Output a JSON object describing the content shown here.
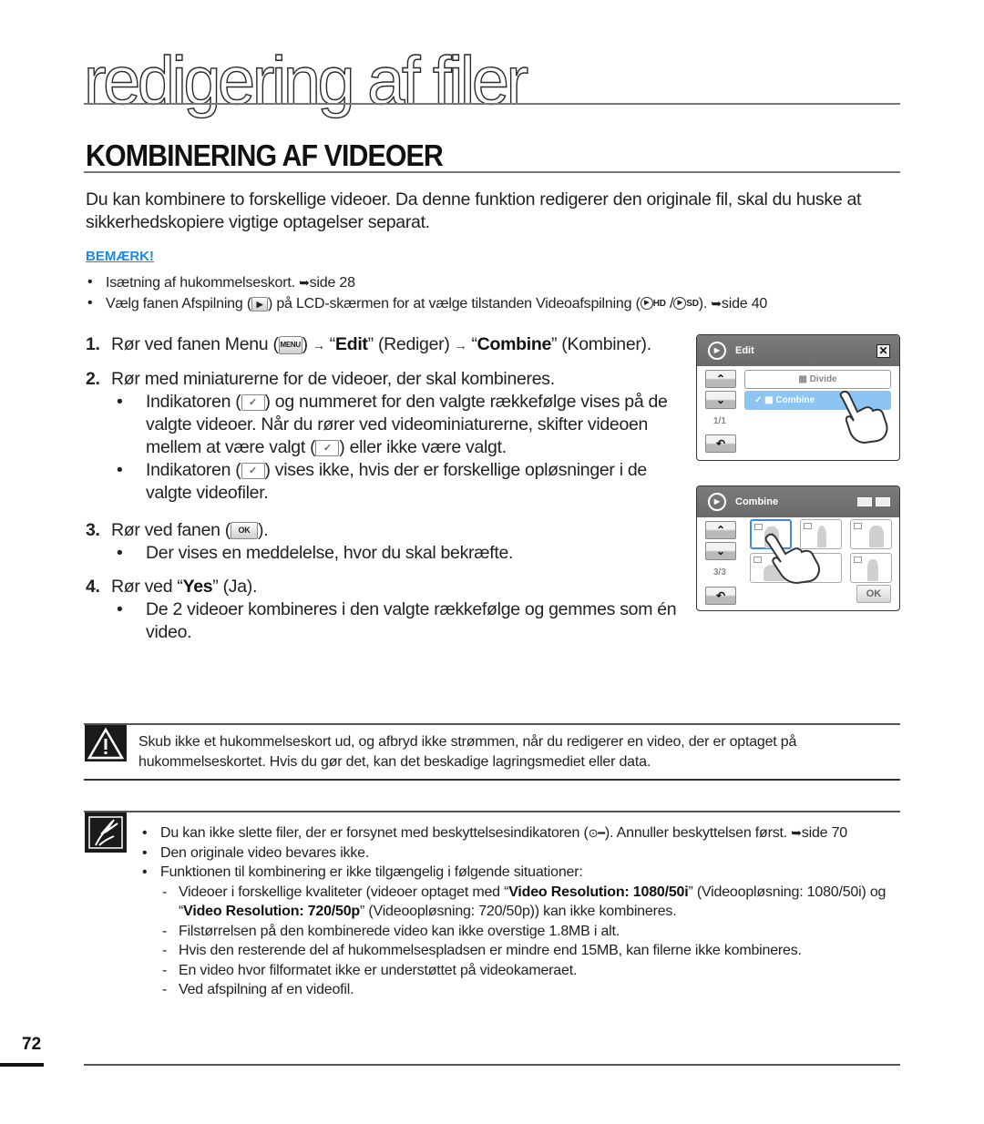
{
  "header": {
    "chapter_title": "redigering af filer",
    "section_title": "KOMBINERING AF VIDEOER"
  },
  "intro": "Du kan kombinere to forskellige videoer. Da denne funktion redigerer den originale fil, skal du huske at sikkerhedskopiere vigtige optagelser separat.",
  "note": {
    "label": "BEMÆRK!",
    "items": [
      {
        "text": "Isætning af hukommelseskort. ",
        "ref_arrow": "➥",
        "ref": "side 28"
      },
      {
        "text_before": "Vælg fanen Afspilning (",
        "icon": "play-tab-icon",
        "text_mid": ") på LCD-skærmen for at vælge tilstanden Videoafspilning (",
        "mode_hd": "HD",
        "mode_sd": "SD",
        "text_after": "). ",
        "ref_arrow": "➥",
        "ref": "side 40"
      }
    ]
  },
  "steps": [
    {
      "num": "1.",
      "parts": {
        "a": "Rør ved fanen Menu (",
        "menu_icon": "MENU",
        "b": ") ",
        "arrow": "→",
        "c": " “",
        "edit": "Edit",
        "d": "” (Rediger) ",
        "e": " “",
        "combine": "Combine",
        "f": "” (Kombiner)."
      }
    },
    {
      "num": "2.",
      "text": "Rør med miniaturerne for de videoer, der skal kombineres.",
      "subs": [
        {
          "a": "Indikatoren (",
          "b": ") og nummeret for den valgte rækkefølge vises på de valgte videoer. Når du rører ved videominiaturerne, skifter videoen mellem at være valgt (",
          "c": ") eller ikke være valgt."
        },
        {
          "a": "Indikatoren (",
          "b": ") vises ikke, hvis der er forskellige opløsninger i de valgte videofiler."
        }
      ]
    },
    {
      "num": "3.",
      "a": "Rør ved fanen (",
      "ok_icon": "OK",
      "b": ").",
      "subs": [
        "Der vises en meddelelse, hvor du skal bekræfte."
      ]
    },
    {
      "num": "4.",
      "a": "Rør ved “",
      "yes": "Yes",
      "b": "” (Ja).",
      "subs": [
        "De 2 videoer kombineres i den valgte rækkefølge og gemmes som én video."
      ]
    }
  ],
  "check_glyph": "✓",
  "lcd_edit": {
    "title": "Edit",
    "close": "✕",
    "up": "⌃",
    "down": "⌄",
    "counter": "1/1",
    "back": "↶",
    "items": [
      {
        "label": "Divide",
        "icon": "▦",
        "selected": false
      },
      {
        "label": "Combine",
        "icon": "▦",
        "check": "✓",
        "selected": true
      }
    ]
  },
  "lcd_combine": {
    "title": "Combine",
    "up": "⌃",
    "down": "⌄",
    "counter": "3/3",
    "back": "↶",
    "ok": "OK",
    "selected_number": "1",
    "thumbnail_count": 6
  },
  "warning": {
    "text": "Skub ikke et hukommelseskort ud, og afbryd ikke strømmen, når du redigerer en video, der er optaget på hukommelseskortet. Hvis du gør det, kan det beskadige lagringsmediet eller data."
  },
  "notes": {
    "items": [
      {
        "a": "Du kan ikke slette filer, der er forsynet med beskyttelsesindikatoren (",
        "key": "⊙━",
        "b": "). Annuller beskyttelsen først. ",
        "ref_arrow": "➥",
        "ref": "side 70"
      },
      {
        "text": "Den originale video bevares ikke."
      },
      {
        "text": "Funktionen til kombinering er ikke tilgængelig i følgende situationer:"
      }
    ],
    "sub_items": [
      {
        "a": "Videoer i forskellige kvaliteter (videoer optaget med “",
        "b1": "Video Resolution: 1080/50i",
        "c": "” (Videoopløsning: 1080/50i) og “",
        "b2": "Video Resolution: 720/50p",
        "d": "” (Videoopløsning: 720/50p)) kan ikke kombineres."
      },
      {
        "text": "Filstørrelsen på den kombinerede video kan ikke overstige 1.8MB i alt."
      },
      {
        "text": "Hvis den resterende del af hukommelsespladsen er mindre end 15MB, kan filerne ikke kombineres."
      },
      {
        "text": "En video hvor filformatet ikke er understøttet på videokameraet."
      },
      {
        "text": "Ved afspilning af en videofil."
      }
    ]
  },
  "footer": {
    "page_number": "72"
  },
  "colors": {
    "note_label": "#1e88e5",
    "lcd_header": "#707070",
    "lcd_selected": "#8cc4f4",
    "thumb_selected": "#3b8ae0"
  }
}
